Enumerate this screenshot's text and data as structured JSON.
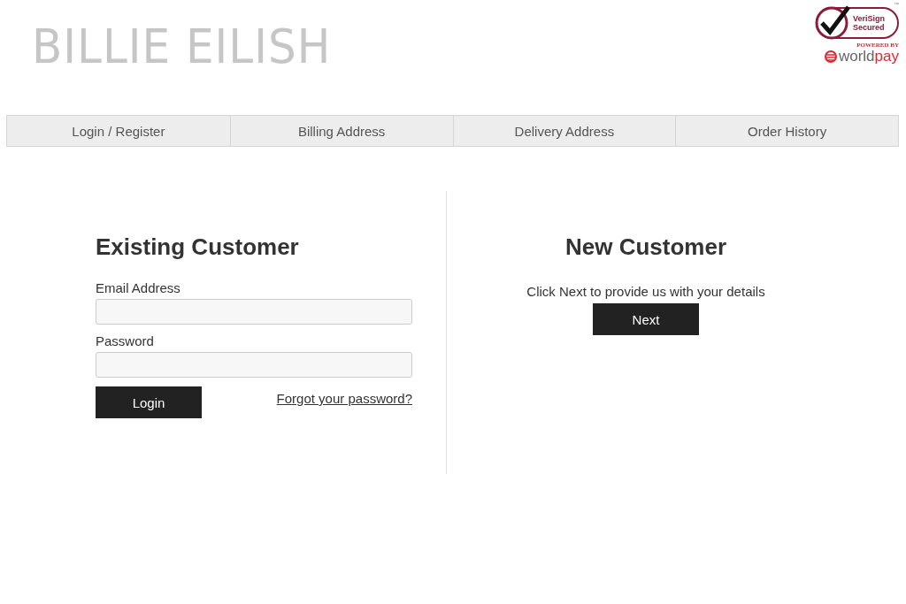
{
  "header": {
    "logo": "BILLIE EILISH",
    "badge": {
      "verisign_line_1": "VeriSign",
      "verisign_line_2": "Secured",
      "trademark": "™",
      "powered_by": "POWERED BY",
      "worldpay_prefix": "world",
      "worldpay_suffix": "pay"
    }
  },
  "tabs": [
    {
      "label": "Login / Register",
      "selected": false
    },
    {
      "label": "Billing Address",
      "selected": false
    },
    {
      "label": "Delivery Address",
      "selected": false
    },
    {
      "label": "Order History",
      "selected": false
    }
  ],
  "existing_customer": {
    "heading": "Existing Customer",
    "fields": [
      {
        "label": "Email Address"
      },
      {
        "label": "Password"
      }
    ],
    "login_button": "Login",
    "forgot_link": "Forgot your password?"
  },
  "new_customer": {
    "heading": "New Customer",
    "text": "Click Next to provide us with your details",
    "next_button": "Next"
  }
}
